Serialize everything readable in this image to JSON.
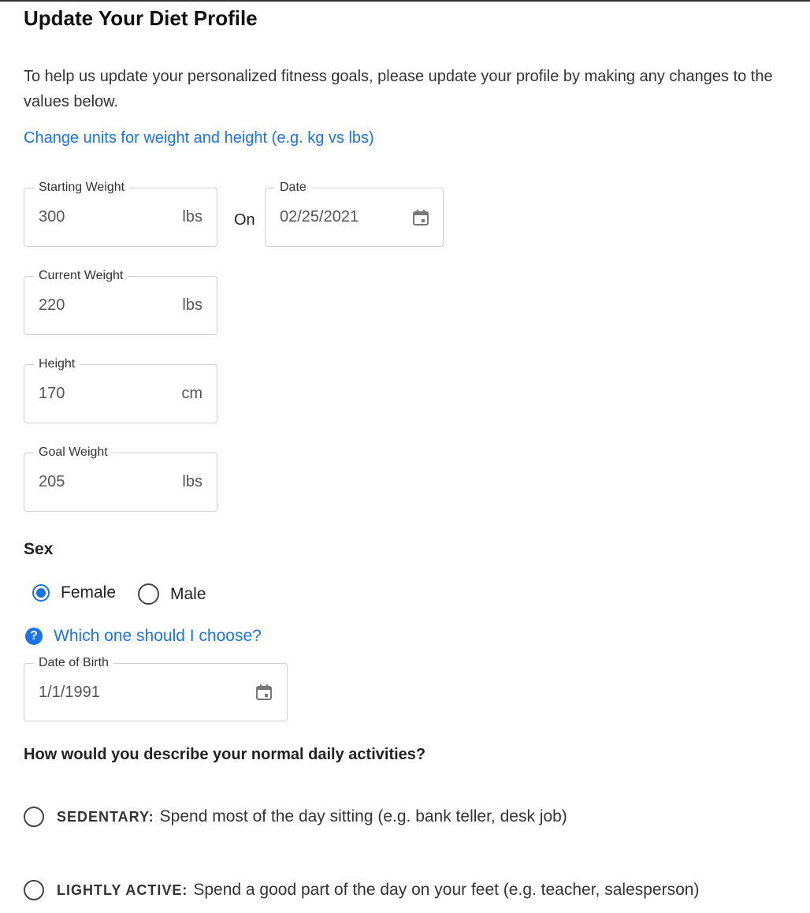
{
  "header": {
    "title": "Update Your Diet Profile"
  },
  "intro": {
    "text": "To help us update your personalized fitness goals, please update your profile by making any changes to the values below."
  },
  "units_link": {
    "label": "Change units for weight and height (e.g. kg vs lbs)"
  },
  "fields": {
    "starting_weight": {
      "label": "Starting Weight",
      "value": "300",
      "unit": "lbs"
    },
    "on_label": "On",
    "start_date": {
      "label": "Date",
      "value": "02/25/2021"
    },
    "current_weight": {
      "label": "Current Weight",
      "value": "220",
      "unit": "lbs"
    },
    "height": {
      "label": "Height",
      "value": "170",
      "unit": "cm"
    },
    "goal_weight": {
      "label": "Goal Weight",
      "value": "205",
      "unit": "lbs"
    }
  },
  "sex": {
    "label": "Sex",
    "options": [
      {
        "label": "Female",
        "selected": true
      },
      {
        "label": "Male",
        "selected": false
      }
    ],
    "help_link": "Which one should I choose?"
  },
  "date_of_birth": {
    "label": "Date of Birth",
    "value": "1/1/1991"
  },
  "activities": {
    "question": "How would you describe your normal daily activities?",
    "options": [
      {
        "name": "SEDENTARY:",
        "description": "Spend most of the day sitting (e.g. bank teller, desk job)",
        "selected": false
      },
      {
        "name": "LIGHTLY ACTIVE:",
        "description": "Spend a good part of the day on your feet (e.g. teacher, salesperson)",
        "selected": false
      }
    ]
  },
  "colors": {
    "accent": "#1a73e8",
    "border": "#cfcfcf",
    "text": "#222222"
  },
  "icons": {
    "calendar": "calendar-icon",
    "help": "help-circle-icon",
    "radio": "radio-icon"
  }
}
